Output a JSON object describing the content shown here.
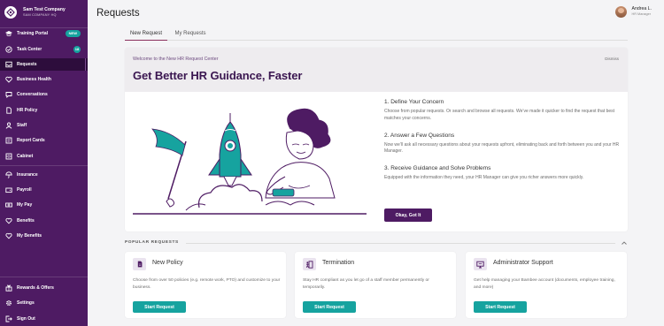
{
  "sidebar": {
    "company_name": "Sam Test Company",
    "company_sub": "SAM COMPANY HQ",
    "items": [
      {
        "label": "Training Portal",
        "icon": "graduation-cap-icon",
        "badge": "NEW"
      },
      {
        "label": "Task Center",
        "icon": "check-circle-icon",
        "badge": "18"
      },
      {
        "label": "Requests",
        "icon": "inbox-icon",
        "active": true
      },
      {
        "label": "Business Health",
        "icon": "heart-icon"
      },
      {
        "label": "Conversations",
        "icon": "chat-bubble-icon"
      },
      {
        "label": "HR Policy",
        "icon": "document-icon"
      },
      {
        "label": "Staff",
        "icon": "person-icon"
      },
      {
        "label": "Report Cards",
        "icon": "report-card-icon"
      },
      {
        "label": "Cabinet",
        "icon": "cabinet-icon"
      },
      {
        "label": "Insurance",
        "icon": "umbrella-icon"
      },
      {
        "label": "Payroll",
        "icon": "wallet-icon"
      },
      {
        "label": "My Pay",
        "icon": "money-icon"
      },
      {
        "label": "Benefits",
        "icon": "heart-hand-icon"
      },
      {
        "label": "My Benefits",
        "icon": "heart-hand-icon"
      },
      {
        "label": "Rewards & Offers",
        "icon": "gift-icon"
      },
      {
        "label": "Settings",
        "icon": "gear-icon"
      },
      {
        "label": "Sign Out",
        "icon": "sign-out-icon"
      }
    ]
  },
  "header": {
    "title": "Requests",
    "user_name": "Andrea L.",
    "user_role": "HR Manager"
  },
  "tabs": [
    {
      "label": "New Request",
      "active": true
    },
    {
      "label": "My Requests",
      "active": false
    }
  ],
  "hero": {
    "welcome": "Welcome to the New HR Request Center",
    "dismiss": "Dismiss",
    "headline": "Get Better HR Guidance, Faster",
    "steps": [
      {
        "title": "1. Define Your Concern",
        "text": "Choose from popular requests. Or search and browse all requests. We’ve made it quicker to find the request that best matches your concerns."
      },
      {
        "title": "2. Answer a Few Questions",
        "text": "Now we’ll ask all necessary questions about your requests upfront, eliminating back and forth between you and your HR Manager."
      },
      {
        "title": "3. Receive Guidance and Solve Problems",
        "text": "Equipped with the information they need, your HR Manager can give you richer answers more quickly."
      }
    ],
    "button": "Okay, Got It"
  },
  "popular": {
    "header": "POPULAR REQUESTS",
    "cards": [
      {
        "title": "New Policy",
        "icon": "document-icon",
        "desc": "Choose from over 50 policies (e.g. remote work, PTO) and customize to your business.",
        "button": "Start Request"
      },
      {
        "title": "Termination",
        "icon": "exit-door-icon",
        "desc": "Stay HR compliant as you let go of a staff member permanently or temporarily.",
        "button": "Start Request"
      },
      {
        "title": "Administrator Support",
        "icon": "monitor-icon",
        "desc": "Get help managing your Bambee account (documents, employee training, and more)",
        "button": "Start Request"
      }
    ]
  },
  "colors": {
    "sidebar": "#4e1b63",
    "accent_teal": "#16a39f",
    "headline": "#3a1650",
    "primary_button": "#4e1b63"
  }
}
